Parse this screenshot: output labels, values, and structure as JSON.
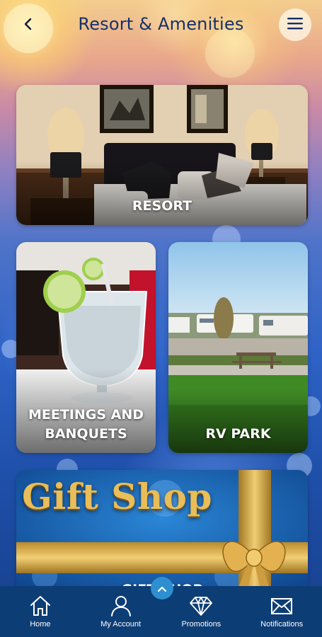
{
  "header": {
    "title": "Resort & Amenities",
    "back_icon": "chevron-left-icon",
    "menu_icon": "hamburger-menu-icon"
  },
  "cards": {
    "resort": {
      "label": "RESORT"
    },
    "meetings": {
      "label_line1": "MEETINGS AND",
      "label_line2": "BANQUETS"
    },
    "rv_park": {
      "label": "RV PARK"
    },
    "gift_shop": {
      "banner_text": "Gift Shop",
      "label_partial": "GIFT SHOP"
    }
  },
  "scroll_top_icon": "chevron-up-icon",
  "tabbar": {
    "items": [
      {
        "label": "Home",
        "icon": "home-icon"
      },
      {
        "label": "My Account",
        "icon": "user-icon"
      },
      {
        "label": "Promotions",
        "icon": "diamond-icon"
      },
      {
        "label": "Notifications",
        "icon": "envelope-icon"
      }
    ]
  },
  "colors": {
    "title": "#14306a",
    "tabbar_bg": "#0d3d75",
    "scroll_top_button": "#2d8fd0",
    "gold": "#e9bd58"
  }
}
